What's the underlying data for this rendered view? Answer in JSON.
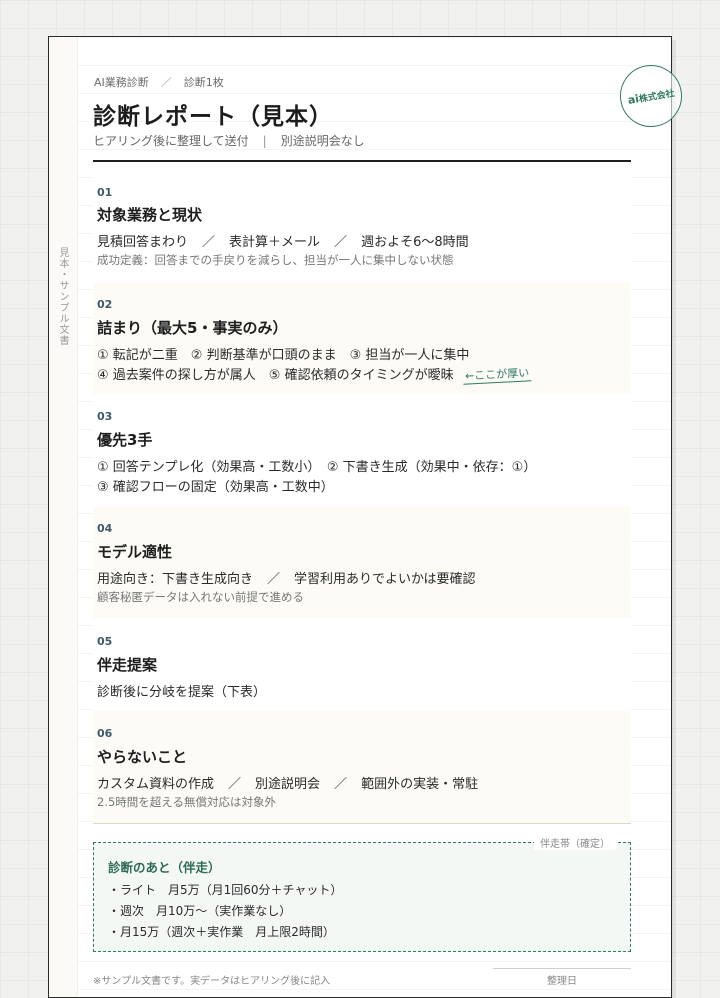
{
  "header": {
    "breadcrumb": [
      "AI業務診断",
      "診断1枚"
    ],
    "title": "診断レポート（見本）",
    "subtitle": [
      "ヒアリング後に整理して送付",
      "別途説明会なし"
    ],
    "stamp": {
      "prefix": "ai",
      "text": "株式会社"
    }
  },
  "side_label": "見本・サンプル文書",
  "sections": [
    {
      "num": "01",
      "title": "対象業務と現状",
      "parts": [
        "見積回答まわり",
        "／",
        "表計算＋メール",
        "／",
        "週およそ6〜8時間"
      ],
      "note": "成功定義：回答までの手戻りを減らし、担当が一人に集中しない状態"
    },
    {
      "num": "02",
      "title": "詰まり（最大5・事実のみ）",
      "line1": "① 転記が二重　② 判断基準が口頭のまま　③ 担当が一人に集中",
      "line2": "④ 過去案件の探し方が属人　⑤ 確認依頼のタイミングが曖昧",
      "annotation": "←ここが厚い"
    },
    {
      "num": "03",
      "title": "優先3手",
      "line1": "① 回答テンプレ化（効果高・工数小）　② 下書き生成（効果中・依存：①）",
      "line2": "③ 確認フローの固定（効果高・工数中）"
    },
    {
      "num": "04",
      "title": "モデル適性",
      "parts": [
        "用途向き：下書き生成向き",
        "／",
        "学習利用ありでよいかは要確認"
      ],
      "note": "顧客秘匿データは入れない前提で進める"
    },
    {
      "num": "05",
      "title": "伴走提案",
      "line1": "診断後に分岐を提案（下表）"
    },
    {
      "num": "06",
      "title": "やらないこと",
      "parts": [
        "カスタム資料の作成",
        "／",
        "別途説明会",
        "／",
        "範囲外の実装・常駐"
      ],
      "note": "2.5時間を超える無償対応は対象外"
    }
  ],
  "support": {
    "tag": "伴走帯（確定）",
    "title": "診断のあと（伴走）",
    "items": [
      "・ライト　月5万（月1回60分＋チャット）",
      "・週次　月10万〜（実作業なし）",
      "・月15万（週次＋実作業　月上限2時間）"
    ]
  },
  "footer": {
    "note": "※サンプル文書です。実データはヒアリング後に記入",
    "date_label": "整理日"
  }
}
